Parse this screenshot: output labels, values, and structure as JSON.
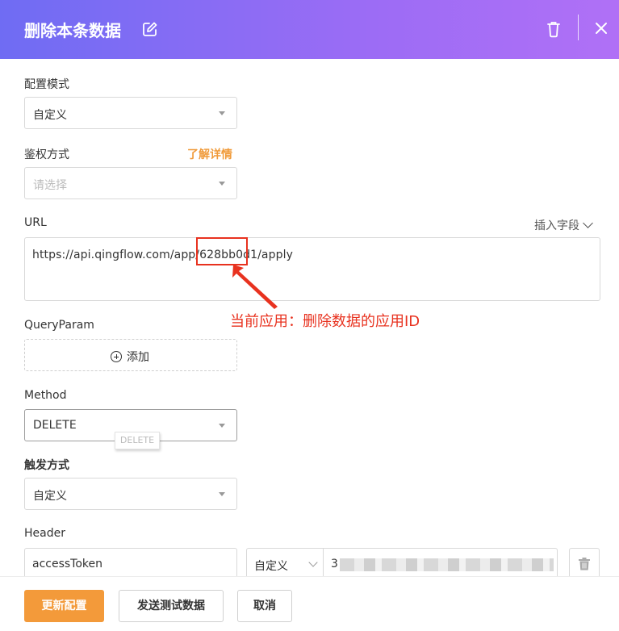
{
  "header": {
    "title": "删除本条数据",
    "icons": [
      "edit-icon",
      "trash-icon",
      "close-icon"
    ],
    "gradient_colors": [
      "#6f6cf3",
      "#b070f6"
    ]
  },
  "config_mode": {
    "label": "配置模式",
    "value": "自定义"
  },
  "auth": {
    "label": "鉴权方式",
    "link": "了解详情",
    "placeholder": "请选择"
  },
  "url": {
    "label": "URL",
    "insert_field": "插入字段",
    "value": "https://api.qingflow.com/app/628bb0d1/apply"
  },
  "annotation": {
    "text": "当前应用：删除数据的应用ID",
    "color": "#e8321f"
  },
  "query_param": {
    "label": "QueryParam",
    "add_label": "添加"
  },
  "method": {
    "label": "Method",
    "value": "DELETE",
    "tooltip": "DELETE"
  },
  "trigger": {
    "label": "触发方式",
    "value": "自定义"
  },
  "header_section": {
    "label": "Header",
    "key": "accessToken",
    "mode": "自定义",
    "value_prefix": "3"
  },
  "footer": {
    "update_label": "更新配置",
    "test_label": "发送测试数据",
    "cancel_label": "取消",
    "accent_color": "#f39a3a"
  }
}
